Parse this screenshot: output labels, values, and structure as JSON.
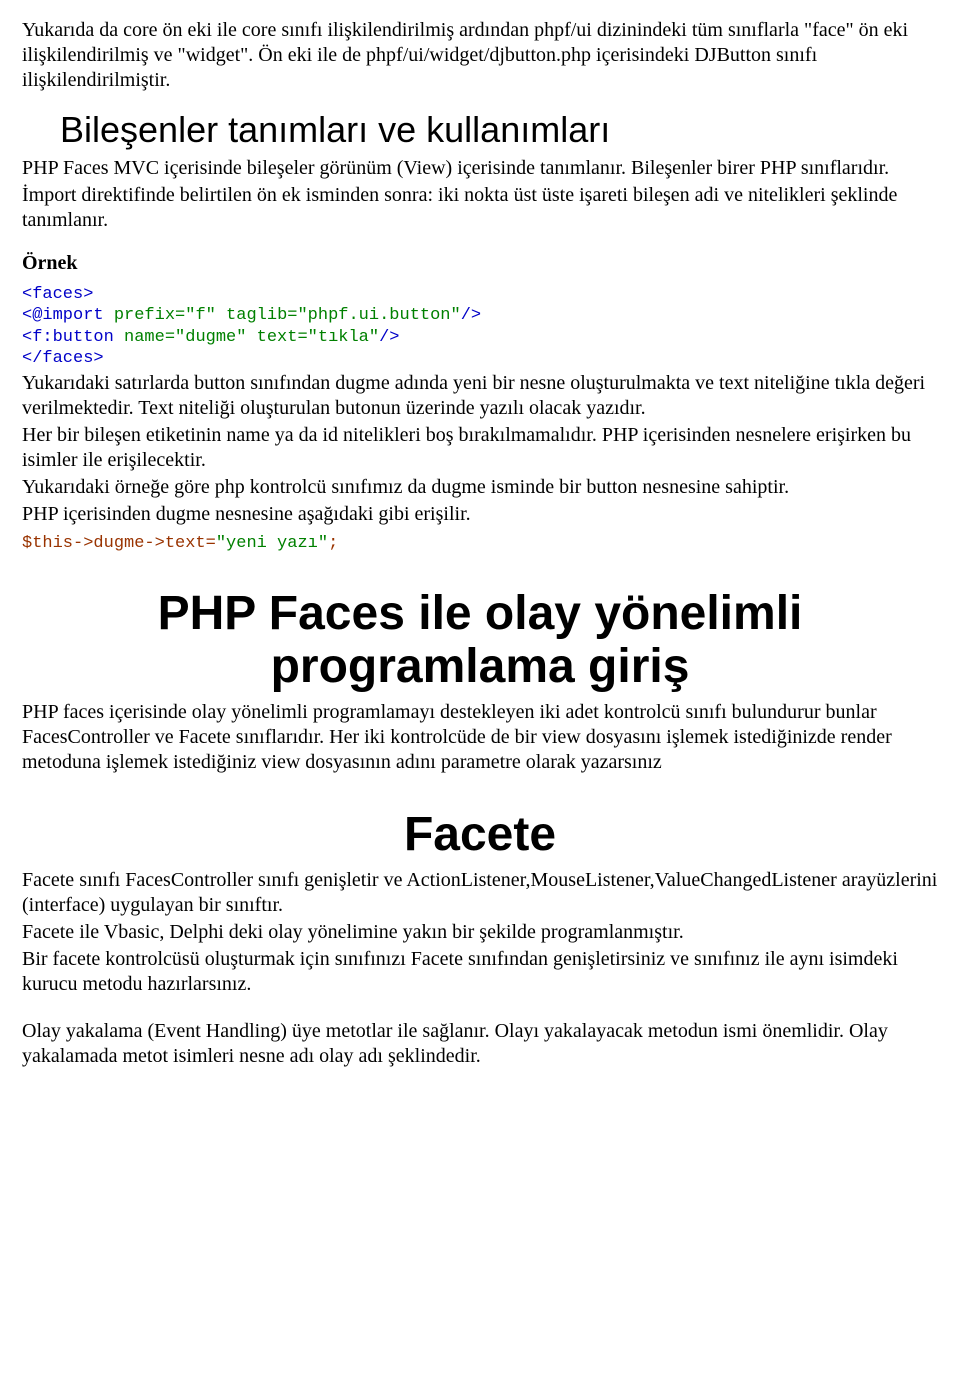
{
  "p1": "Yukarıda da core ön eki ile core sınıfı ilişkilendirilmiş ardından phpf/ui dizinindeki tüm sınıflarla \"face\" ön eki ilişkilendirilmiş ve \"widget\". Ön eki ile de phpf/ui/widget/djbutton.php içerisindeki DJButton sınıfı ilişkilendirilmiştir.",
  "h_bilesen": "Bileşenler tanımları ve kullanımları",
  "p2": "PHP Faces MVC içerisinde bileşeler görünüm (View) içerisinde tanımlanır. Bileşenler birer PHP sınıflarıdır.",
  "p3": "İmport direktifinde belirtilen ön ek isminden sonra: iki nokta üst üste işareti bileşen adi ve nitelikleri şeklinde tanımlanır.",
  "ornek_label": "Örnek",
  "code1": {
    "l1a": "<faces>",
    "l2a": "<@import ",
    "l2b": "prefix=\"f\"",
    "l2c": " taglib=\"phpf.ui.button\"",
    "l2d": "/>",
    "l3a": "<f:button ",
    "l3b": "name=\"dugme\"",
    "l3c": " text=\"tıkla\"",
    "l3d": "/>",
    "l4a": "</faces>"
  },
  "p4": "Yukarıdaki satırlarda button sınıfından dugme adında yeni bir nesne oluşturulmakta ve text niteliğine tıkla değeri verilmektedir.  Text niteliği oluşturulan butonun üzerinde yazılı olacak yazıdır.",
  "p5": "Her bir bileşen etiketinin name ya da id nitelikleri boş bırakılmamalıdır. PHP içerisinden nesnelere erişirken bu isimler ile erişilecektir.",
  "p6": "Yukarıdaki örneğe göre php kontrolcü sınıfımız da dugme isminde bir button nesnesine sahiptir.",
  "p7": "PHP içerisinden dugme nesnesine aşağıdaki gibi erişilir.",
  "code2": {
    "a": "$this->dugme->text=",
    "b": "\"yeni yazı\"",
    "c": ";"
  },
  "h_phpfaces_l1": "PHP Faces ile olay yönelimli",
  "h_phpfaces_l2": "programlama giriş",
  "p8": "PHP faces içerisinde olay yönelimli programlamayı destekleyen iki adet kontrolcü sınıfı bulundurur bunlar FacesController ve Facete sınıflarıdır. Her iki kontrolcüde de bir view dosyasını işlemek istediğinizde render metoduna işlemek istediğiniz view dosyasının adını parametre olarak yazarsınız",
  "h_facete": "Facete",
  "p9": "Facete sınıfı FacesController sınıfı genişletir ve ActionListener,MouseListener,ValueChangedListener arayüzlerini (interface) uygulayan bir sınıftır.",
  "p10": "Facete ile Vbasic, Delphi deki olay yönelimine yakın bir şekilde programlanmıştır.",
  "p11": "Bir facete kontrolcüsü oluşturmak için sınıfınızı Facete sınıfından genişletirsiniz ve sınıfınız ile aynı isimdeki kurucu metodu hazırlarsınız.",
  "p12": "Olay yakalama (Event Handling) üye metotlar ile sağlanır. Olayı yakalayacak metodun ismi önemlidir. Olay yakalamada metot isimleri nesne adı olay adı şeklindedir."
}
